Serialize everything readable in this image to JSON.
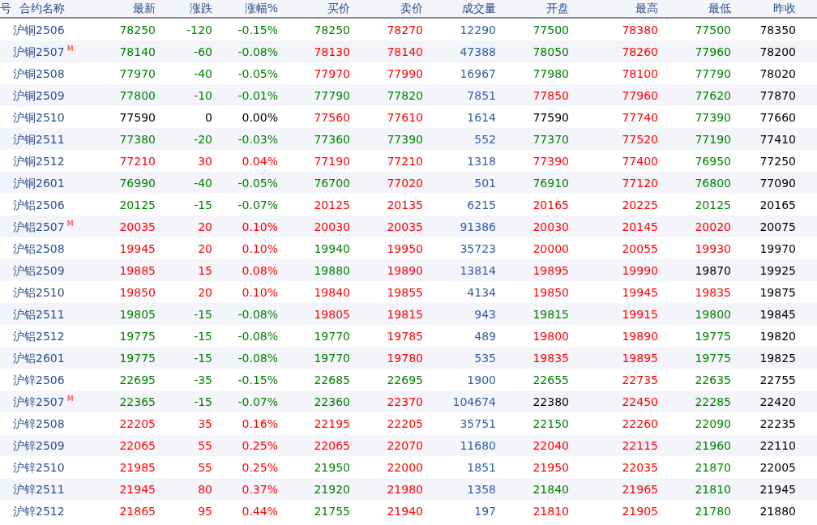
{
  "table": {
    "row_number_header": "号",
    "columns": [
      "合约名称",
      "最新",
      "涨跌",
      "涨幅%",
      "买价",
      "卖价",
      "成交量",
      "开盘",
      "最高",
      "最低",
      "昨收"
    ],
    "rows": [
      {
        "cells": [
          {
            "text": "沪铜2506"
          },
          {
            "text": "78250",
            "color": "#008000"
          },
          {
            "text": "-120",
            "color": "#008000"
          },
          {
            "text": "-0.15%",
            "color": "#008000"
          },
          {
            "text": "78250",
            "color": "#008000"
          },
          {
            "text": "78270",
            "color": "#ff0000"
          },
          {
            "text": "12290",
            "color": "#2f5ea8"
          },
          {
            "text": "77500",
            "color": "#008000"
          },
          {
            "text": "78380",
            "color": "#ff0000"
          },
          {
            "text": "77500",
            "color": "#008000"
          },
          {
            "text": "78350",
            "color": "#000000"
          }
        ]
      },
      {
        "cells": [
          {
            "text": "沪铜2507",
            "badge": "M"
          },
          {
            "text": "78140",
            "color": "#008000"
          },
          {
            "text": "-60",
            "color": "#008000"
          },
          {
            "text": "-0.08%",
            "color": "#008000"
          },
          {
            "text": "78130",
            "color": "#ff0000"
          },
          {
            "text": "78140",
            "color": "#ff0000"
          },
          {
            "text": "47388",
            "color": "#2f5ea8"
          },
          {
            "text": "78050",
            "color": "#008000"
          },
          {
            "text": "78260",
            "color": "#ff0000"
          },
          {
            "text": "77960",
            "color": "#008000"
          },
          {
            "text": "78200",
            "color": "#000000"
          }
        ]
      },
      {
        "cells": [
          {
            "text": "沪铜2508"
          },
          {
            "text": "77970",
            "color": "#008000"
          },
          {
            "text": "-40",
            "color": "#008000"
          },
          {
            "text": "-0.05%",
            "color": "#008000"
          },
          {
            "text": "77970",
            "color": "#ff0000"
          },
          {
            "text": "77990",
            "color": "#ff0000"
          },
          {
            "text": "16967",
            "color": "#2f5ea8"
          },
          {
            "text": "77980",
            "color": "#008000"
          },
          {
            "text": "78100",
            "color": "#ff0000"
          },
          {
            "text": "77790",
            "color": "#008000"
          },
          {
            "text": "78020",
            "color": "#000000"
          }
        ]
      },
      {
        "cells": [
          {
            "text": "沪铜2509"
          },
          {
            "text": "77800",
            "color": "#008000"
          },
          {
            "text": "-10",
            "color": "#008000"
          },
          {
            "text": "-0.01%",
            "color": "#008000"
          },
          {
            "text": "77790",
            "color": "#008000"
          },
          {
            "text": "77820",
            "color": "#008000"
          },
          {
            "text": "7851",
            "color": "#2f5ea8"
          },
          {
            "text": "77850",
            "color": "#ff0000"
          },
          {
            "text": "77960",
            "color": "#ff0000"
          },
          {
            "text": "77620",
            "color": "#008000"
          },
          {
            "text": "77870",
            "color": "#000000"
          }
        ]
      },
      {
        "cells": [
          {
            "text": "沪铜2510"
          },
          {
            "text": "77590",
            "color": "#000000"
          },
          {
            "text": "0",
            "color": "#000000"
          },
          {
            "text": "0.00%",
            "color": "#000000"
          },
          {
            "text": "77560",
            "color": "#ff0000"
          },
          {
            "text": "77610",
            "color": "#ff0000"
          },
          {
            "text": "1614",
            "color": "#2f5ea8"
          },
          {
            "text": "77590",
            "color": "#000000"
          },
          {
            "text": "77740",
            "color": "#ff0000"
          },
          {
            "text": "77390",
            "color": "#008000"
          },
          {
            "text": "77660",
            "color": "#000000"
          }
        ]
      },
      {
        "cells": [
          {
            "text": "沪铜2511"
          },
          {
            "text": "77380",
            "color": "#008000"
          },
          {
            "text": "-20",
            "color": "#008000"
          },
          {
            "text": "-0.03%",
            "color": "#008000"
          },
          {
            "text": "77360",
            "color": "#008000"
          },
          {
            "text": "77390",
            "color": "#008000"
          },
          {
            "text": "552",
            "color": "#2f5ea8"
          },
          {
            "text": "77370",
            "color": "#008000"
          },
          {
            "text": "77520",
            "color": "#ff0000"
          },
          {
            "text": "77190",
            "color": "#008000"
          },
          {
            "text": "77410",
            "color": "#000000"
          }
        ]
      },
      {
        "cells": [
          {
            "text": "沪铜2512"
          },
          {
            "text": "77210",
            "color": "#ff0000"
          },
          {
            "text": "30",
            "color": "#ff0000"
          },
          {
            "text": "0.04%",
            "color": "#ff0000"
          },
          {
            "text": "77190",
            "color": "#ff0000"
          },
          {
            "text": "77210",
            "color": "#ff0000"
          },
          {
            "text": "1318",
            "color": "#2f5ea8"
          },
          {
            "text": "77390",
            "color": "#ff0000"
          },
          {
            "text": "77400",
            "color": "#ff0000"
          },
          {
            "text": "76950",
            "color": "#008000"
          },
          {
            "text": "77250",
            "color": "#000000"
          }
        ]
      },
      {
        "cells": [
          {
            "text": "沪铜2601"
          },
          {
            "text": "76990",
            "color": "#008000"
          },
          {
            "text": "-40",
            "color": "#008000"
          },
          {
            "text": "-0.05%",
            "color": "#008000"
          },
          {
            "text": "76700",
            "color": "#008000"
          },
          {
            "text": "77020",
            "color": "#ff0000"
          },
          {
            "text": "501",
            "color": "#2f5ea8"
          },
          {
            "text": "76910",
            "color": "#008000"
          },
          {
            "text": "77120",
            "color": "#ff0000"
          },
          {
            "text": "76800",
            "color": "#008000"
          },
          {
            "text": "77090",
            "color": "#000000"
          }
        ]
      },
      {
        "cells": [
          {
            "text": "沪铝2506"
          },
          {
            "text": "20125",
            "color": "#008000"
          },
          {
            "text": "-15",
            "color": "#008000"
          },
          {
            "text": "-0.07%",
            "color": "#008000"
          },
          {
            "text": "20125",
            "color": "#ff0000"
          },
          {
            "text": "20135",
            "color": "#ff0000"
          },
          {
            "text": "6215",
            "color": "#2f5ea8"
          },
          {
            "text": "20165",
            "color": "#ff0000"
          },
          {
            "text": "20225",
            "color": "#ff0000"
          },
          {
            "text": "20125",
            "color": "#008000"
          },
          {
            "text": "20165",
            "color": "#000000"
          }
        ]
      },
      {
        "cells": [
          {
            "text": "沪铝2507",
            "badge": "M"
          },
          {
            "text": "20035",
            "color": "#ff0000"
          },
          {
            "text": "20",
            "color": "#ff0000"
          },
          {
            "text": "0.10%",
            "color": "#ff0000"
          },
          {
            "text": "20030",
            "color": "#ff0000"
          },
          {
            "text": "20035",
            "color": "#ff0000"
          },
          {
            "text": "91386",
            "color": "#2f5ea8"
          },
          {
            "text": "20030",
            "color": "#ff0000"
          },
          {
            "text": "20145",
            "color": "#ff0000"
          },
          {
            "text": "20020",
            "color": "#ff0000"
          },
          {
            "text": "20075",
            "color": "#000000"
          }
        ]
      },
      {
        "cells": [
          {
            "text": "沪铝2508"
          },
          {
            "text": "19945",
            "color": "#ff0000"
          },
          {
            "text": "20",
            "color": "#ff0000"
          },
          {
            "text": "0.10%",
            "color": "#ff0000"
          },
          {
            "text": "19940",
            "color": "#008000"
          },
          {
            "text": "19950",
            "color": "#ff0000"
          },
          {
            "text": "35723",
            "color": "#2f5ea8"
          },
          {
            "text": "20000",
            "color": "#ff0000"
          },
          {
            "text": "20055",
            "color": "#ff0000"
          },
          {
            "text": "19930",
            "color": "#ff0000"
          },
          {
            "text": "19970",
            "color": "#000000"
          }
        ]
      },
      {
        "cells": [
          {
            "text": "沪铝2509"
          },
          {
            "text": "19885",
            "color": "#ff0000"
          },
          {
            "text": "15",
            "color": "#ff0000"
          },
          {
            "text": "0.08%",
            "color": "#ff0000"
          },
          {
            "text": "19880",
            "color": "#008000"
          },
          {
            "text": "19890",
            "color": "#ff0000"
          },
          {
            "text": "13814",
            "color": "#2f5ea8"
          },
          {
            "text": "19895",
            "color": "#ff0000"
          },
          {
            "text": "19990",
            "color": "#ff0000"
          },
          {
            "text": "19870",
            "color": "#000000"
          },
          {
            "text": "19925",
            "color": "#000000"
          }
        ]
      },
      {
        "cells": [
          {
            "text": "沪铝2510"
          },
          {
            "text": "19850",
            "color": "#ff0000"
          },
          {
            "text": "20",
            "color": "#ff0000"
          },
          {
            "text": "0.10%",
            "color": "#ff0000"
          },
          {
            "text": "19840",
            "color": "#ff0000"
          },
          {
            "text": "19855",
            "color": "#ff0000"
          },
          {
            "text": "4134",
            "color": "#2f5ea8"
          },
          {
            "text": "19850",
            "color": "#ff0000"
          },
          {
            "text": "19945",
            "color": "#ff0000"
          },
          {
            "text": "19835",
            "color": "#ff0000"
          },
          {
            "text": "19875",
            "color": "#000000"
          }
        ]
      },
      {
        "cells": [
          {
            "text": "沪铝2511"
          },
          {
            "text": "19805",
            "color": "#008000"
          },
          {
            "text": "-15",
            "color": "#008000"
          },
          {
            "text": "-0.08%",
            "color": "#008000"
          },
          {
            "text": "19805",
            "color": "#ff0000"
          },
          {
            "text": "19815",
            "color": "#ff0000"
          },
          {
            "text": "943",
            "color": "#2f5ea8"
          },
          {
            "text": "19815",
            "color": "#008000"
          },
          {
            "text": "19915",
            "color": "#ff0000"
          },
          {
            "text": "19800",
            "color": "#008000"
          },
          {
            "text": "19845",
            "color": "#000000"
          }
        ]
      },
      {
        "cells": [
          {
            "text": "沪铝2512"
          },
          {
            "text": "19775",
            "color": "#008000"
          },
          {
            "text": "-15",
            "color": "#008000"
          },
          {
            "text": "-0.08%",
            "color": "#008000"
          },
          {
            "text": "19770",
            "color": "#008000"
          },
          {
            "text": "19785",
            "color": "#ff0000"
          },
          {
            "text": "489",
            "color": "#2f5ea8"
          },
          {
            "text": "19800",
            "color": "#ff0000"
          },
          {
            "text": "19890",
            "color": "#ff0000"
          },
          {
            "text": "19775",
            "color": "#008000"
          },
          {
            "text": "19820",
            "color": "#000000"
          }
        ]
      },
      {
        "cells": [
          {
            "text": "沪铝2601"
          },
          {
            "text": "19775",
            "color": "#008000"
          },
          {
            "text": "-15",
            "color": "#008000"
          },
          {
            "text": "-0.08%",
            "color": "#008000"
          },
          {
            "text": "19770",
            "color": "#008000"
          },
          {
            "text": "19780",
            "color": "#ff0000"
          },
          {
            "text": "535",
            "color": "#2f5ea8"
          },
          {
            "text": "19835",
            "color": "#ff0000"
          },
          {
            "text": "19895",
            "color": "#ff0000"
          },
          {
            "text": "19775",
            "color": "#008000"
          },
          {
            "text": "19825",
            "color": "#000000"
          }
        ]
      },
      {
        "cells": [
          {
            "text": "沪锌2506"
          },
          {
            "text": "22695",
            "color": "#008000"
          },
          {
            "text": "-35",
            "color": "#008000"
          },
          {
            "text": "-0.15%",
            "color": "#008000"
          },
          {
            "text": "22685",
            "color": "#008000"
          },
          {
            "text": "22695",
            "color": "#008000"
          },
          {
            "text": "1900",
            "color": "#2f5ea8"
          },
          {
            "text": "22655",
            "color": "#008000"
          },
          {
            "text": "22735",
            "color": "#ff0000"
          },
          {
            "text": "22635",
            "color": "#008000"
          },
          {
            "text": "22755",
            "color": "#000000"
          }
        ]
      },
      {
        "cells": [
          {
            "text": "沪锌2507",
            "badge": "M"
          },
          {
            "text": "22365",
            "color": "#008000"
          },
          {
            "text": "-15",
            "color": "#008000"
          },
          {
            "text": "-0.07%",
            "color": "#008000"
          },
          {
            "text": "22360",
            "color": "#008000"
          },
          {
            "text": "22370",
            "color": "#ff0000"
          },
          {
            "text": "104674",
            "color": "#2f5ea8"
          },
          {
            "text": "22380",
            "color": "#000000"
          },
          {
            "text": "22450",
            "color": "#ff0000"
          },
          {
            "text": "22285",
            "color": "#008000"
          },
          {
            "text": "22420",
            "color": "#000000"
          }
        ]
      },
      {
        "cells": [
          {
            "text": "沪锌2508"
          },
          {
            "text": "22205",
            "color": "#ff0000"
          },
          {
            "text": "35",
            "color": "#ff0000"
          },
          {
            "text": "0.16%",
            "color": "#ff0000"
          },
          {
            "text": "22195",
            "color": "#ff0000"
          },
          {
            "text": "22205",
            "color": "#ff0000"
          },
          {
            "text": "35751",
            "color": "#2f5ea8"
          },
          {
            "text": "22150",
            "color": "#008000"
          },
          {
            "text": "22260",
            "color": "#ff0000"
          },
          {
            "text": "22090",
            "color": "#008000"
          },
          {
            "text": "22235",
            "color": "#000000"
          }
        ]
      },
      {
        "cells": [
          {
            "text": "沪锌2509"
          },
          {
            "text": "22065",
            "color": "#ff0000"
          },
          {
            "text": "55",
            "color": "#ff0000"
          },
          {
            "text": "0.25%",
            "color": "#ff0000"
          },
          {
            "text": "22065",
            "color": "#ff0000"
          },
          {
            "text": "22070",
            "color": "#ff0000"
          },
          {
            "text": "11680",
            "color": "#2f5ea8"
          },
          {
            "text": "22040",
            "color": "#ff0000"
          },
          {
            "text": "22115",
            "color": "#ff0000"
          },
          {
            "text": "21960",
            "color": "#008000"
          },
          {
            "text": "22110",
            "color": "#000000"
          }
        ]
      },
      {
        "cells": [
          {
            "text": "沪锌2510"
          },
          {
            "text": "21985",
            "color": "#ff0000"
          },
          {
            "text": "55",
            "color": "#ff0000"
          },
          {
            "text": "0.25%",
            "color": "#ff0000"
          },
          {
            "text": "21950",
            "color": "#008000"
          },
          {
            "text": "22000",
            "color": "#ff0000"
          },
          {
            "text": "1851",
            "color": "#2f5ea8"
          },
          {
            "text": "21950",
            "color": "#ff0000"
          },
          {
            "text": "22035",
            "color": "#ff0000"
          },
          {
            "text": "21870",
            "color": "#008000"
          },
          {
            "text": "22005",
            "color": "#000000"
          }
        ]
      },
      {
        "cells": [
          {
            "text": "沪锌2511"
          },
          {
            "text": "21945",
            "color": "#ff0000"
          },
          {
            "text": "80",
            "color": "#ff0000"
          },
          {
            "text": "0.37%",
            "color": "#ff0000"
          },
          {
            "text": "21920",
            "color": "#008000"
          },
          {
            "text": "21980",
            "color": "#ff0000"
          },
          {
            "text": "1358",
            "color": "#2f5ea8"
          },
          {
            "text": "21840",
            "color": "#008000"
          },
          {
            "text": "21965",
            "color": "#ff0000"
          },
          {
            "text": "21810",
            "color": "#008000"
          },
          {
            "text": "21945",
            "color": "#000000"
          }
        ]
      },
      {
        "cells": [
          {
            "text": "沪锌2512"
          },
          {
            "text": "21865",
            "color": "#ff0000"
          },
          {
            "text": "95",
            "color": "#ff0000"
          },
          {
            "text": "0.44%",
            "color": "#ff0000"
          },
          {
            "text": "21755",
            "color": "#008000"
          },
          {
            "text": "21940",
            "color": "#ff0000"
          },
          {
            "text": "197",
            "color": "#2f5ea8"
          },
          {
            "text": "21810",
            "color": "#ff0000"
          },
          {
            "text": "21905",
            "color": "#ff0000"
          },
          {
            "text": "21780",
            "color": "#008000"
          },
          {
            "text": "21880",
            "color": "#000000"
          }
        ]
      }
    ]
  }
}
